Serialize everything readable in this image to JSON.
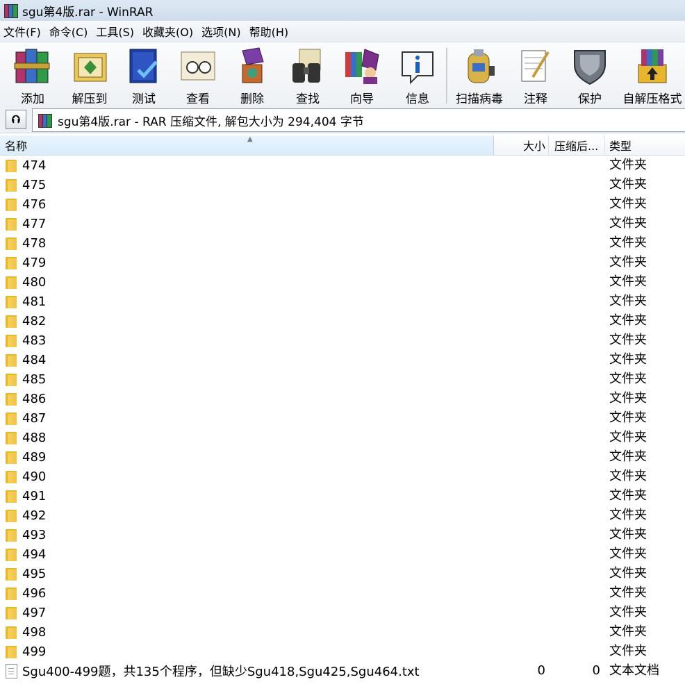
{
  "window": {
    "title": "sgu第4版.rar - WinRAR"
  },
  "menu": [
    "文件(F)",
    "命令(C)",
    "工具(S)",
    "收藏夹(O)",
    "选项(N)",
    "帮助(H)"
  ],
  "toolbar": [
    {
      "label": "添加",
      "icon": "add-archive-icon"
    },
    {
      "label": "解压到",
      "icon": "extract-to-icon"
    },
    {
      "label": "测试",
      "icon": "test-icon"
    },
    {
      "label": "查看",
      "icon": "view-icon"
    },
    {
      "label": "删除",
      "icon": "delete-icon"
    },
    {
      "label": "查找",
      "icon": "find-icon"
    },
    {
      "label": "向导",
      "icon": "wizard-icon"
    },
    {
      "label": "信息",
      "icon": "info-icon"
    },
    {
      "label": "扫描病毒",
      "icon": "virus-scan-icon"
    },
    {
      "label": "注释",
      "icon": "comment-icon"
    },
    {
      "label": "保护",
      "icon": "protect-icon"
    },
    {
      "label": "自解压格式",
      "icon": "sfx-icon"
    }
  ],
  "address": {
    "path": "sgu第4版.rar - RAR 压缩文件, 解包大小为 294,404 字节"
  },
  "columns": {
    "name": "名称",
    "size": "大小",
    "packed": "压缩后...",
    "type": "类型"
  },
  "files": [
    {
      "name": "474",
      "size": "",
      "packed": "",
      "type": "文件夹",
      "kind": "folder"
    },
    {
      "name": "475",
      "size": "",
      "packed": "",
      "type": "文件夹",
      "kind": "folder"
    },
    {
      "name": "476",
      "size": "",
      "packed": "",
      "type": "文件夹",
      "kind": "folder"
    },
    {
      "name": "477",
      "size": "",
      "packed": "",
      "type": "文件夹",
      "kind": "folder"
    },
    {
      "name": "478",
      "size": "",
      "packed": "",
      "type": "文件夹",
      "kind": "folder"
    },
    {
      "name": "479",
      "size": "",
      "packed": "",
      "type": "文件夹",
      "kind": "folder"
    },
    {
      "name": "480",
      "size": "",
      "packed": "",
      "type": "文件夹",
      "kind": "folder"
    },
    {
      "name": "481",
      "size": "",
      "packed": "",
      "type": "文件夹",
      "kind": "folder"
    },
    {
      "name": "482",
      "size": "",
      "packed": "",
      "type": "文件夹",
      "kind": "folder"
    },
    {
      "name": "483",
      "size": "",
      "packed": "",
      "type": "文件夹",
      "kind": "folder"
    },
    {
      "name": "484",
      "size": "",
      "packed": "",
      "type": "文件夹",
      "kind": "folder"
    },
    {
      "name": "485",
      "size": "",
      "packed": "",
      "type": "文件夹",
      "kind": "folder"
    },
    {
      "name": "486",
      "size": "",
      "packed": "",
      "type": "文件夹",
      "kind": "folder"
    },
    {
      "name": "487",
      "size": "",
      "packed": "",
      "type": "文件夹",
      "kind": "folder"
    },
    {
      "name": "488",
      "size": "",
      "packed": "",
      "type": "文件夹",
      "kind": "folder"
    },
    {
      "name": "489",
      "size": "",
      "packed": "",
      "type": "文件夹",
      "kind": "folder"
    },
    {
      "name": "490",
      "size": "",
      "packed": "",
      "type": "文件夹",
      "kind": "folder"
    },
    {
      "name": "491",
      "size": "",
      "packed": "",
      "type": "文件夹",
      "kind": "folder"
    },
    {
      "name": "492",
      "size": "",
      "packed": "",
      "type": "文件夹",
      "kind": "folder"
    },
    {
      "name": "493",
      "size": "",
      "packed": "",
      "type": "文件夹",
      "kind": "folder"
    },
    {
      "name": "494",
      "size": "",
      "packed": "",
      "type": "文件夹",
      "kind": "folder"
    },
    {
      "name": "495",
      "size": "",
      "packed": "",
      "type": "文件夹",
      "kind": "folder"
    },
    {
      "name": "496",
      "size": "",
      "packed": "",
      "type": "文件夹",
      "kind": "folder"
    },
    {
      "name": "497",
      "size": "",
      "packed": "",
      "type": "文件夹",
      "kind": "folder"
    },
    {
      "name": "498",
      "size": "",
      "packed": "",
      "type": "文件夹",
      "kind": "folder"
    },
    {
      "name": "499",
      "size": "",
      "packed": "",
      "type": "文件夹",
      "kind": "folder"
    },
    {
      "name": "Sgu400-499题，共135个程序，但缺少Sgu418,Sgu425,Sgu464.txt",
      "size": "0",
      "packed": "0",
      "type": "文本文档",
      "kind": "file"
    }
  ]
}
